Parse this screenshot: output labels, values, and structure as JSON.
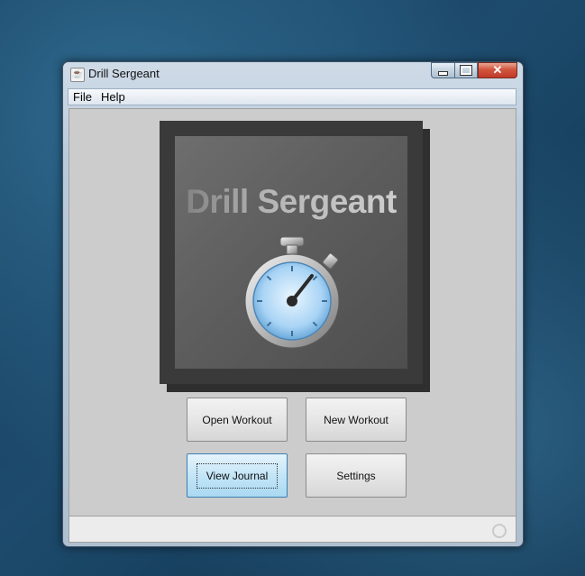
{
  "window": {
    "title": "Drill Sergeant",
    "app_icon": "java-cup-icon"
  },
  "controls": {
    "minimize": "minimize-icon",
    "maximize": "maximize-icon",
    "close": "close-icon",
    "close_glyph": "✕"
  },
  "menubar": {
    "items": [
      {
        "label": "File"
      },
      {
        "label": "Help"
      }
    ]
  },
  "logo": {
    "title": "Drill Sergeant",
    "icon": "stopwatch-icon"
  },
  "buttons": {
    "open_workout": "Open Workout",
    "new_workout": "New Workout",
    "view_journal": "View Journal",
    "settings": "Settings"
  },
  "status": {
    "icon": "busy-indicator-icon"
  },
  "colors": {
    "desktop": "#1d4b6d",
    "client": "#cccccc",
    "focused_button": "#c3e5f7"
  }
}
